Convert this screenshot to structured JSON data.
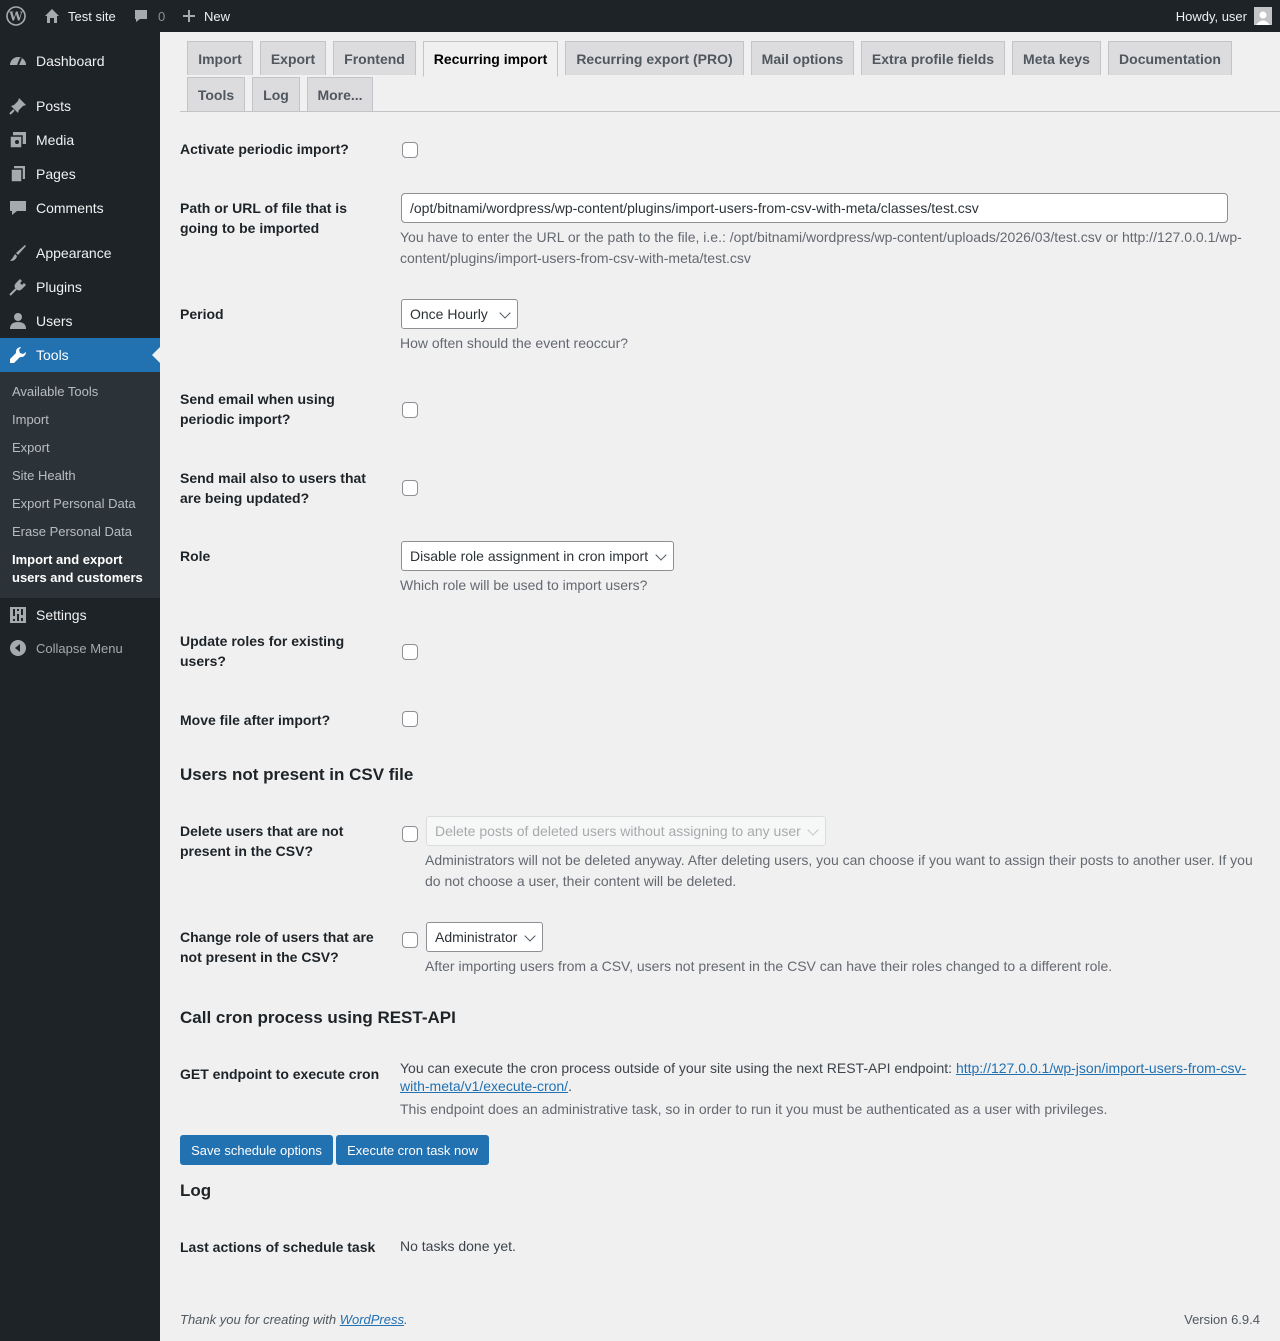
{
  "adminbar": {
    "site": "Test site",
    "comments_count": "0",
    "new": "New",
    "howdy": "Howdy, user"
  },
  "menu": {
    "items": [
      {
        "label": "Dashboard",
        "icon": "dashboard-icon"
      },
      {
        "label": "Posts",
        "icon": "pin-icon"
      },
      {
        "label": "Media",
        "icon": "media-icon"
      },
      {
        "label": "Pages",
        "icon": "pages-icon"
      },
      {
        "label": "Comments",
        "icon": "comment-icon"
      },
      {
        "label": "Appearance",
        "icon": "brush-icon"
      },
      {
        "label": "Plugins",
        "icon": "plug-icon"
      },
      {
        "label": "Users",
        "icon": "user-icon"
      },
      {
        "label": "Tools",
        "icon": "wrench-icon"
      },
      {
        "label": "Settings",
        "icon": "settings-icon"
      },
      {
        "label": "Collapse Menu",
        "icon": "collapse-icon"
      }
    ],
    "submenu": [
      "Available Tools",
      "Import",
      "Export",
      "Site Health",
      "Export Personal Data",
      "Erase Personal Data",
      "Import and export users and customers"
    ]
  },
  "tabs": [
    "Import",
    "Export",
    "Frontend",
    "Recurring import",
    "Recurring export (PRO)",
    "Mail options",
    "Extra profile fields",
    "Meta keys",
    "Documentation",
    "Tools",
    "Log",
    "More..."
  ],
  "form": {
    "activate_label": "Activate periodic import?",
    "path_label": "Path or URL of file that is going to be imported",
    "path_value": "/opt/bitnami/wordpress/wp-content/plugins/import-users-from-csv-with-meta/classes/test.csv",
    "path_desc": "You have to enter the URL or the path to the file, i.e.: /opt/bitnami/wordpress/wp-content/uploads/2026/03/test.csv or http://127.0.0.1/wp-content/plugins/import-users-from-csv-with-meta/test.csv",
    "period_label": "Period",
    "period_value": "Once Hourly",
    "period_desc": "How often should the event reoccur?",
    "send_email_label": "Send email when using periodic import?",
    "send_mail_updated_label": "Send mail also to users that are being updated?",
    "role_label": "Role",
    "role_value": "Disable role assignment in cron import",
    "role_desc": "Which role will be used to import users?",
    "update_roles_label": "Update roles for existing users?",
    "move_file_label": "Move file after import?"
  },
  "not_present": {
    "heading": "Users not present in CSV file",
    "delete_label": "Delete users that are not present in the CSV?",
    "delete_select": "Delete posts of deleted users without assigning to any user",
    "delete_desc": "Administrators will not be deleted anyway. After deleting users, you can choose if you want to assign their posts to another user. If you do not choose a user, their content will be deleted.",
    "change_role_label": "Change role of users that are not present in the CSV?",
    "change_role_select": "Administrator",
    "change_role_desc": "After importing users from a CSV, users not present in the CSV can have their roles changed to a different role."
  },
  "rest": {
    "heading": "Call cron process using REST-API",
    "label": "GET endpoint to execute cron",
    "text": "You can execute the cron process outside of your site using the next REST-API endpoint: ",
    "url": "http://127.0.0.1/wp-json/import-users-from-csv-with-meta/v1/execute-cron/",
    "desc": "This endpoint does an administrative task, so in order to run it you must be authenticated as a user with privileges."
  },
  "buttons": {
    "save": "Save schedule options",
    "execute": "Execute cron task now"
  },
  "log": {
    "heading": "Log",
    "label": "Last actions of schedule task",
    "value": "No tasks done yet."
  },
  "footer": {
    "thanks": "Thank you for creating with ",
    "wp": "WordPress",
    "version": "Version 6.9.4"
  }
}
